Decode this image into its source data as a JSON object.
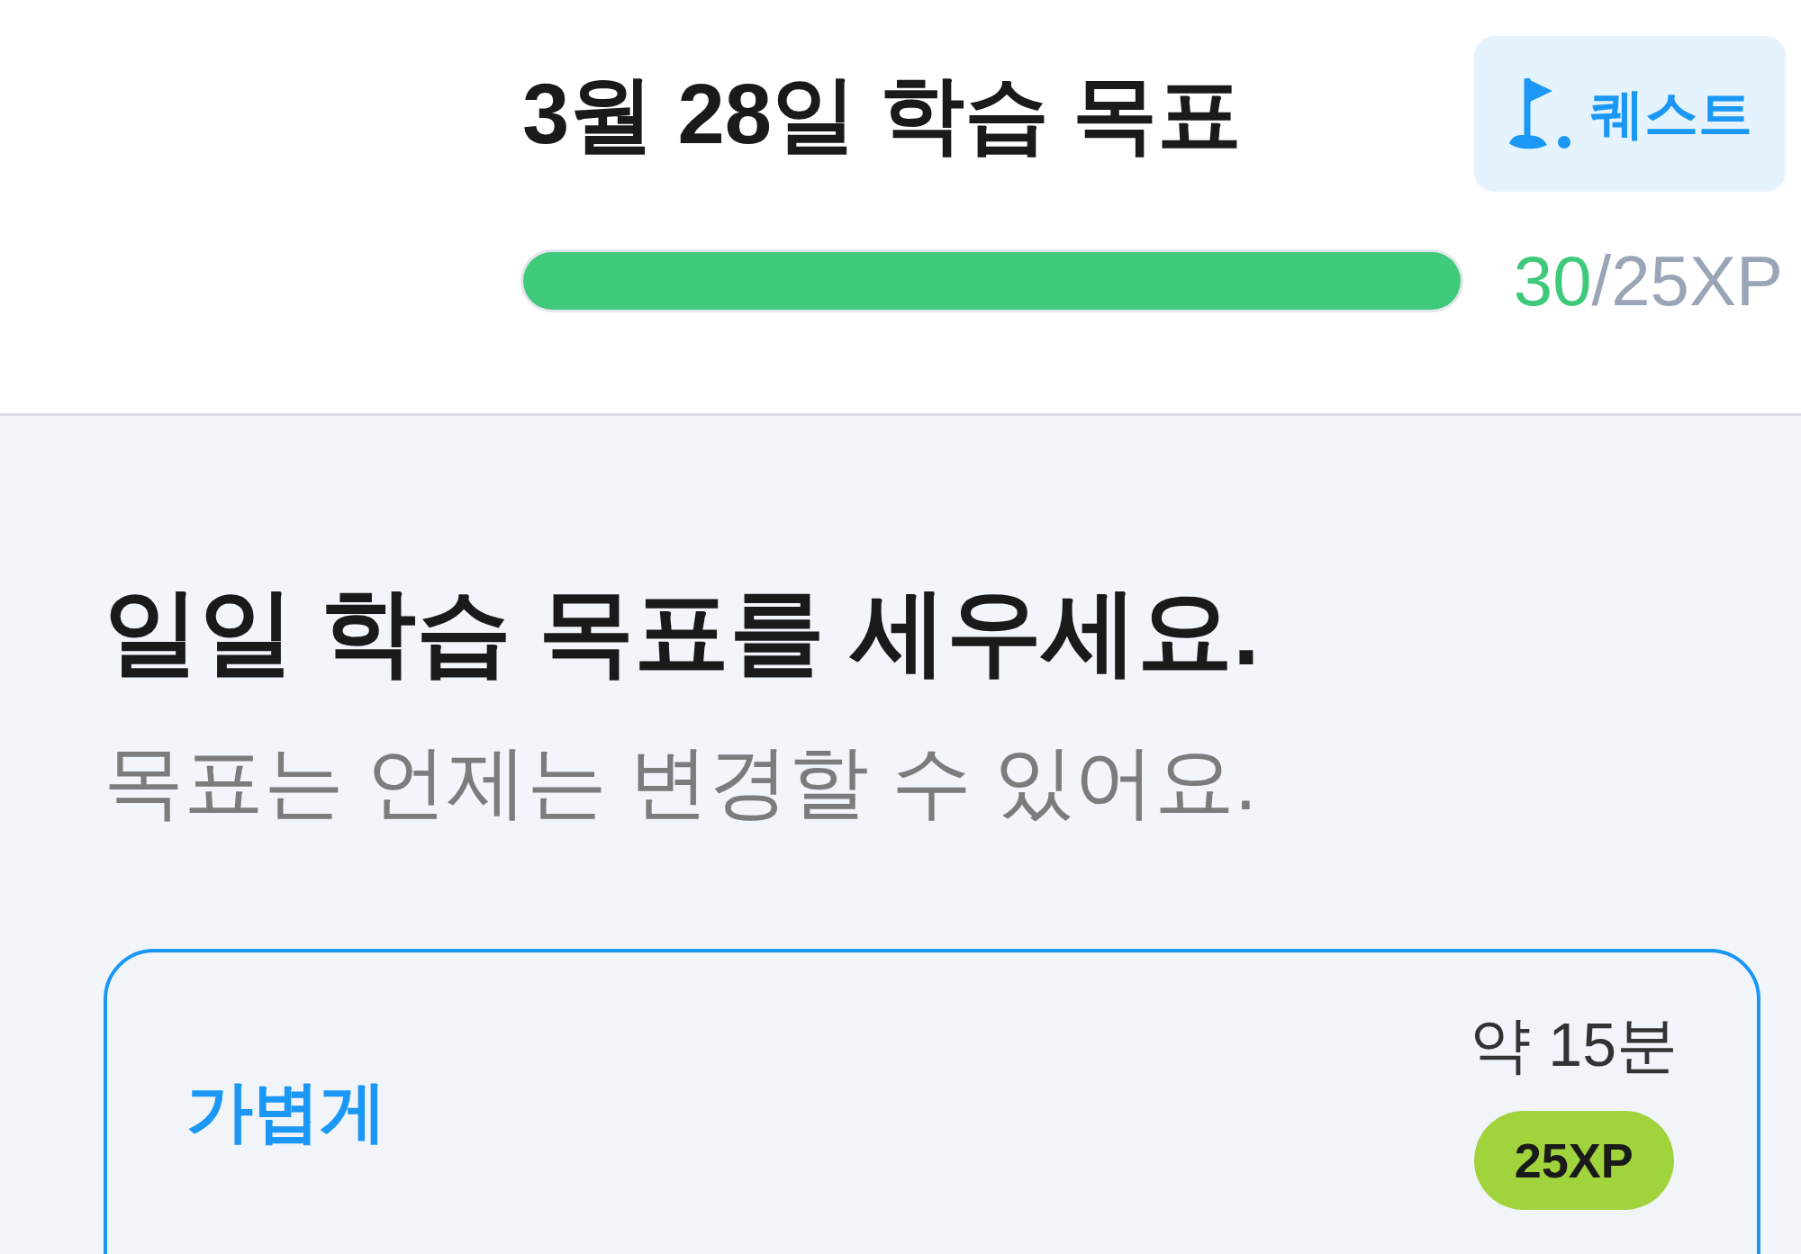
{
  "header": {
    "title": "3월 28일 학습 목표",
    "quest_button": {
      "label": "퀘스트"
    },
    "progress": {
      "level": 1,
      "earned": "30",
      "target": "/25XP"
    }
  },
  "intro": {
    "heading": "일일 학습 목표를 세우세요.",
    "subtitle": "목표는 언제는 변경할 수 있어요."
  },
  "goal_options": [
    {
      "label": "가볍게",
      "duration": "약 15분",
      "reward": "25XP",
      "selected": true
    }
  ]
}
